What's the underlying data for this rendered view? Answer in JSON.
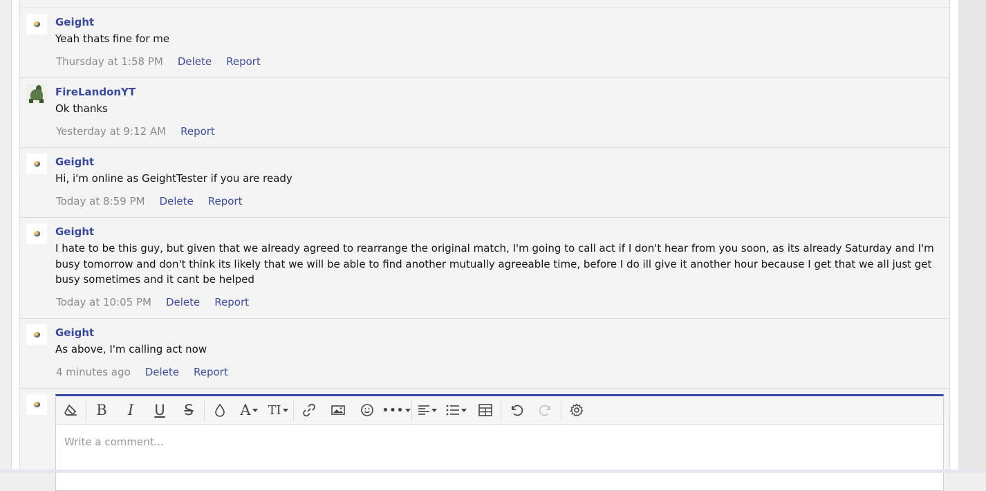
{
  "comments": [
    {
      "author": "Geight",
      "avatar": "pokeball-avatar",
      "text": "Yeah thats fine for me",
      "time": "Thursday at 1:58 PM",
      "delete_label": "Delete",
      "report_label": "Report"
    },
    {
      "author": "FireLandonYT",
      "avatar": "dinosaur-avatar",
      "text": "Ok thanks",
      "time": "Yesterday at 9:12 AM",
      "report_label": "Report"
    },
    {
      "author": "Geight",
      "avatar": "pokeball-avatar",
      "text": "Hi, i'm online as GeightTester if you are ready",
      "time": "Today at 8:59 PM",
      "delete_label": "Delete",
      "report_label": "Report"
    },
    {
      "author": "Geight",
      "avatar": "pokeball-avatar",
      "text": "I hate to be this guy, but given that we already agreed to rearrange the original match, I'm going to call act if I don't hear from you soon, as its already Saturday and I'm busy tomorrow and don't think its likely that we will be able to find another mutually agreeable time, before I do ill give it another hour because I get that we all just get busy sometimes and it cant be helped",
      "time": "Today at 10:05 PM",
      "delete_label": "Delete",
      "report_label": "Report"
    },
    {
      "author": "Geight",
      "avatar": "pokeball-avatar",
      "text": "As above, I'm calling act now",
      "time": "4 minutes ago",
      "delete_label": "Delete",
      "report_label": "Report"
    }
  ],
  "editor": {
    "placeholder": "Write a comment...",
    "toolbar": [
      "clear-formatting-icon",
      "bold-icon",
      "italic-icon",
      "underline-icon",
      "strikethrough-icon",
      "text-color-icon",
      "font-family-icon",
      "font-size-icon",
      "link-icon",
      "image-icon",
      "emoji-icon",
      "more-options-icon",
      "align-icon",
      "list-icon",
      "table-icon",
      "undo-icon",
      "redo-icon",
      "settings-icon"
    ]
  },
  "colors": {
    "author": "#3a4a9a",
    "link": "#3f4d9a",
    "timestamp": "#8a8a8a",
    "editor_accent": "#3545a5"
  }
}
